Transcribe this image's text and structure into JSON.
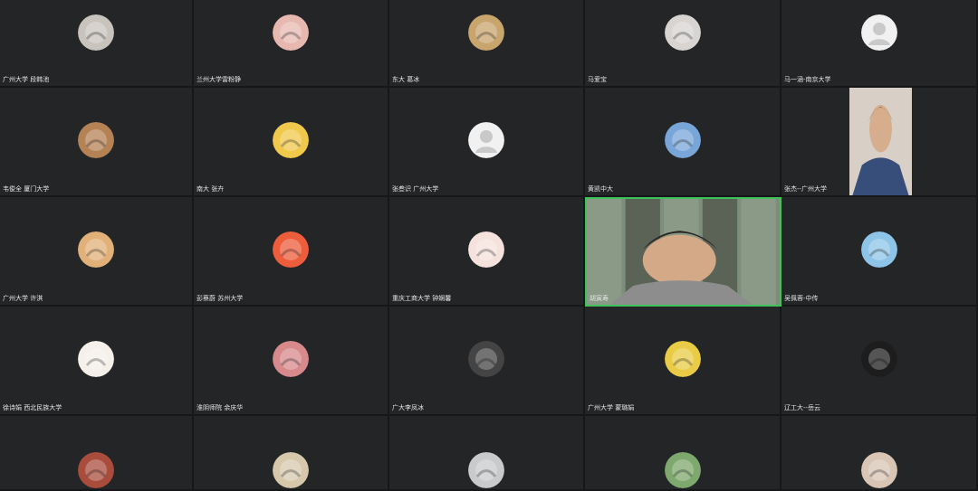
{
  "participants": [
    {
      "name": "广州大学 段韩池",
      "avatar": "photo-dog-icon",
      "color": "#c9c3bd"
    },
    {
      "name": "兰州大学雷粉静",
      "avatar": "pink-flower-icon",
      "color": "#e7b8b0"
    },
    {
      "name": "东大 葛冰",
      "avatar": "cat-photo-icon",
      "color": "#c9a56e"
    },
    {
      "name": "马爱宝",
      "avatar": "white-cat-icon",
      "color": "#d7d4d2"
    },
    {
      "name": "马一涵-南京大学",
      "avatar": "default-user-icon",
      "color": "#f1f1f1"
    },
    {
      "name": "韦俊全 厦门大学",
      "avatar": "bear-photo-icon",
      "color": "#b58256"
    },
    {
      "name": "南大 张卉",
      "avatar": "girl-with-pearl-earring-icon",
      "color": "#f0c84b"
    },
    {
      "name": "张叁识 广州大学",
      "avatar": "default-user-icon",
      "color": "#f1f1f1"
    },
    {
      "name": "黄凯中大",
      "avatar": "colorful-painting-icon",
      "color": "#79a6d8"
    },
    {
      "name": "张杰--广州大学",
      "avatar": "video-man-glasses-icon",
      "color": "#6f88ac"
    },
    {
      "name": "广州大学 许淇",
      "avatar": "girl-photo-icon",
      "color": "#e2b179"
    },
    {
      "name": "彭蔡蔚 苏州大学",
      "avatar": "cartoon-boy-icon",
      "color": "#ed5d3b"
    },
    {
      "name": "重庆工商大学 钟娴馨",
      "avatar": "red-white-logo-icon",
      "color": "#f6e2dc"
    },
    {
      "name": "胡寅寿",
      "avatar": "active-speaker-video-icon",
      "color": "#7b8a7c"
    },
    {
      "name": "吴佩蓉-中传",
      "avatar": "plant-sky-icon",
      "color": "#8ec4e7"
    },
    {
      "name": "徐诗娟 西北民族大学",
      "avatar": "cartoon-face-icon",
      "color": "#f5f1ea"
    },
    {
      "name": "淮阴师院 余庆华",
      "avatar": "city-tower-icon",
      "color": "#d7898b"
    },
    {
      "name": "广大李凤冰",
      "avatar": "cat-black-white-icon",
      "color": "#444444"
    },
    {
      "name": "广州大学 蒙璐娟",
      "avatar": "blonde-girl-icon",
      "color": "#e9cb45"
    },
    {
      "name": "辽工大--岳云",
      "avatar": "dark-window-icon",
      "color": "#1d1d1d"
    },
    {
      "name": "",
      "avatar": "red-pattern-icon",
      "color": "#aa4c3c"
    },
    {
      "name": "",
      "avatar": "cartoon-boy-2-icon",
      "color": "#d7c8ac"
    },
    {
      "name": "",
      "avatar": "landscape-ink-icon",
      "color": "#c9cacb"
    },
    {
      "name": "",
      "avatar": "white-lily-icon",
      "color": "#7ea86e"
    },
    {
      "name": "",
      "avatar": "snoopy-icon",
      "color": "#d9c5b5"
    }
  ]
}
